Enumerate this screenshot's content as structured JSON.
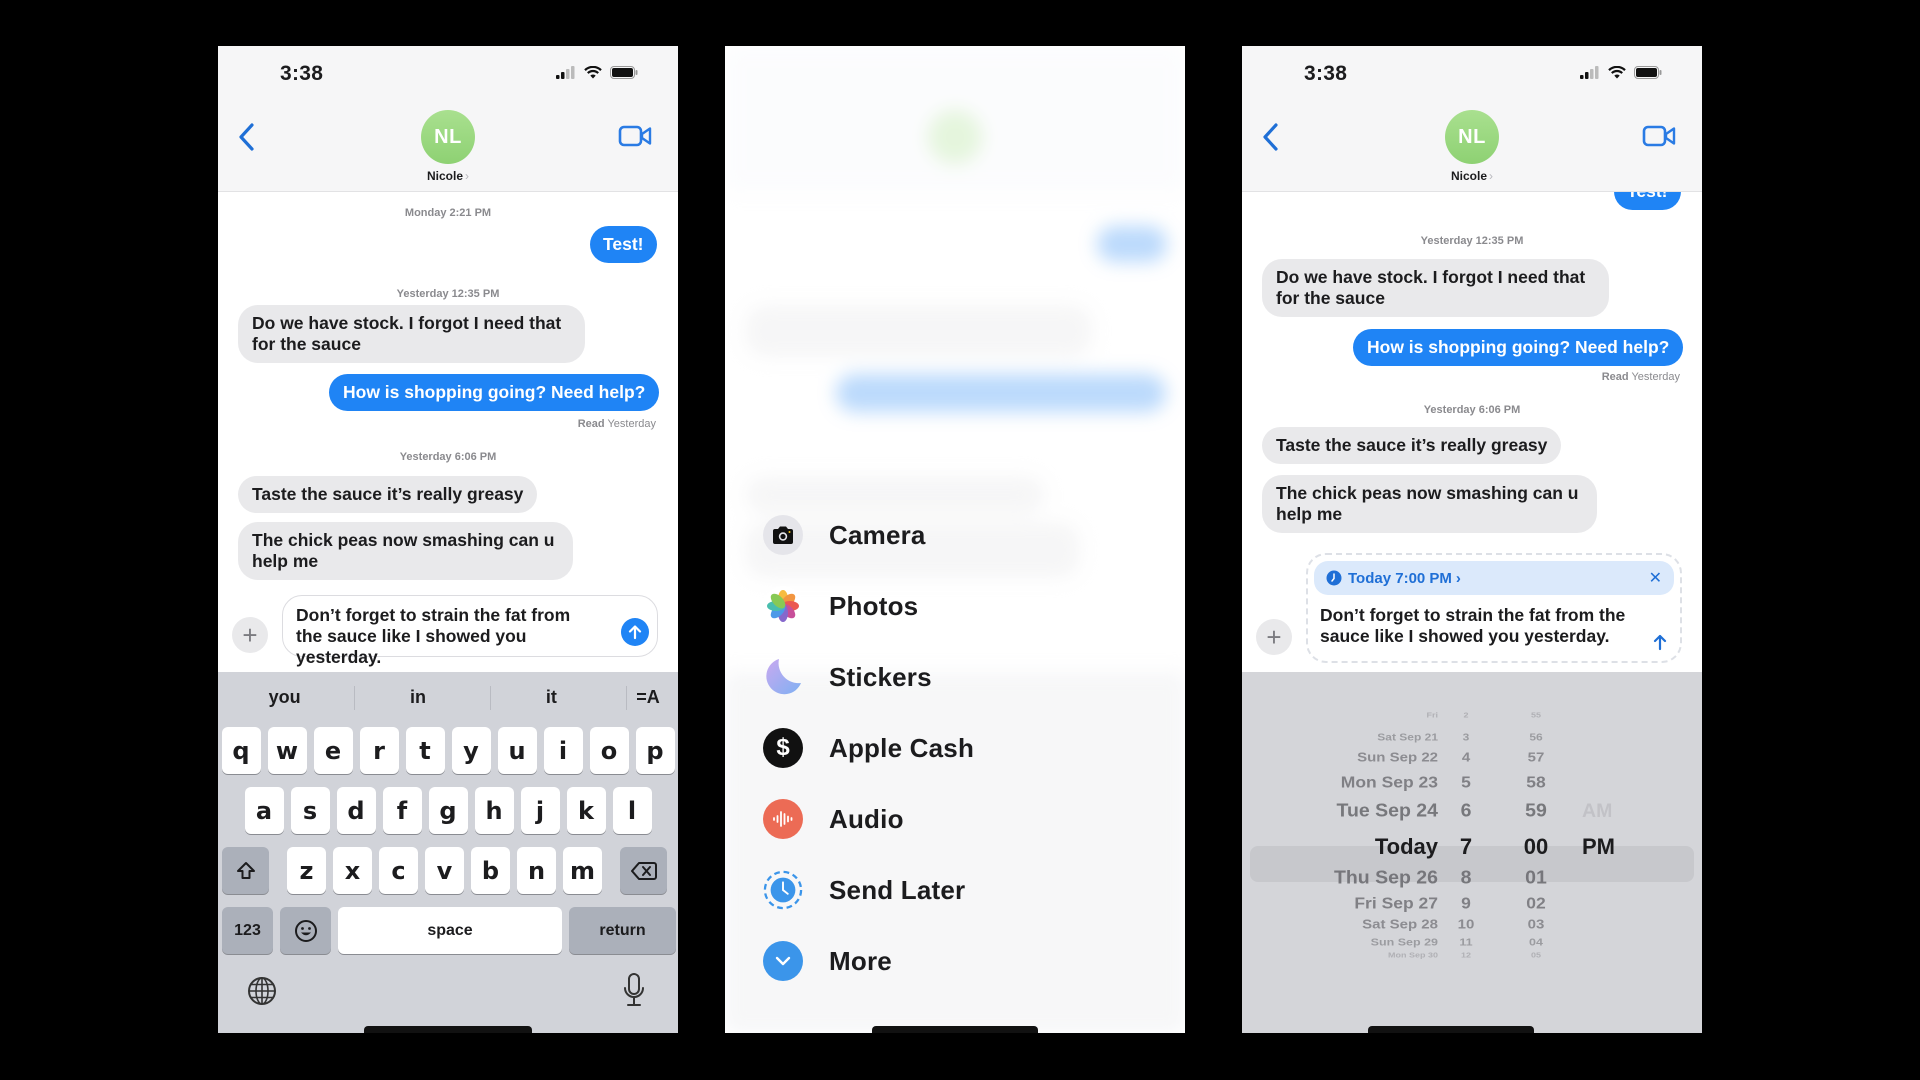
{
  "panels": [
    {
      "status_time": "3:38",
      "contact": {
        "initials": "NL",
        "name": "Nicole",
        "chevron": "›"
      },
      "messages": [
        {
          "type": "timestamp",
          "text": "Monday 2:21 PM"
        },
        {
          "type": "outgoing",
          "text": "Test!"
        },
        {
          "type": "timestamp",
          "text": "Yesterday 12:35 PM"
        },
        {
          "type": "incoming",
          "text": "Do we have stock. I forgot I need that for the sauce"
        },
        {
          "type": "outgoing",
          "text": "How is shopping going? Need help?"
        },
        {
          "type": "receipt",
          "bold": "Read",
          "text": "Yesterday"
        },
        {
          "type": "timestamp",
          "text": "Yesterday 6:06 PM"
        },
        {
          "type": "incoming",
          "text": "Taste the sauce it’s really greasy"
        },
        {
          "type": "incoming",
          "text": "The chick peas now smashing can u help me"
        }
      ],
      "composer": {
        "text": "Don’t forget to strain the fat from the sauce like I showed you yesterday."
      },
      "keyboard": {
        "suggestions": [
          "you",
          "in",
          "it"
        ],
        "format_icon": "=A",
        "row1": [
          "q",
          "w",
          "e",
          "r",
          "t",
          "y",
          "u",
          "i",
          "o",
          "p"
        ],
        "row2": [
          "a",
          "s",
          "d",
          "f",
          "g",
          "h",
          "j",
          "k",
          "l"
        ],
        "row3": [
          "z",
          "x",
          "c",
          "v",
          "b",
          "n",
          "m"
        ],
        "numbers_key": "123",
        "space_key": "space",
        "return_key": "return"
      }
    },
    {
      "menu": [
        {
          "label": "Camera",
          "icon": "camera-icon",
          "color": "#e5e5ea"
        },
        {
          "label": "Photos",
          "icon": "photos-icon",
          "color": "#ffffff"
        },
        {
          "label": "Stickers",
          "icon": "stickers-icon",
          "color": "#a7b3f5"
        },
        {
          "label": "Apple Cash",
          "icon": "dollar-icon",
          "color": "#111111"
        },
        {
          "label": "Audio",
          "icon": "waveform-icon",
          "color": "#ec6b55"
        },
        {
          "label": "Send Later",
          "icon": "clock-icon",
          "color": "#3b95ea"
        },
        {
          "label": "More",
          "icon": "chevron-down-icon",
          "color": "#3b95ea"
        }
      ]
    },
    {
      "status_time": "3:38",
      "contact": {
        "initials": "NL",
        "name": "Nicole",
        "chevron": "›"
      },
      "messages": [
        {
          "type": "outgoing",
          "text": "Test!"
        },
        {
          "type": "timestamp",
          "text": "Yesterday 12:35 PM"
        },
        {
          "type": "incoming",
          "text": "Do we have stock. I forgot I need that for the sauce"
        },
        {
          "type": "outgoing",
          "text": "How is shopping going? Need help?"
        },
        {
          "type": "receipt",
          "bold": "Read",
          "text": "Yesterday"
        },
        {
          "type": "timestamp",
          "text": "Yesterday 6:06 PM"
        },
        {
          "type": "incoming",
          "text": "Taste the sauce it’s really greasy"
        },
        {
          "type": "incoming",
          "text": "The chick peas now smashing can u help me"
        }
      ],
      "scheduled": {
        "when": "Today 7:00 PM",
        "chevron": "›",
        "close": "✕",
        "text": "Don’t forget to strain the fat from the sauce like I showed you yesterday."
      },
      "picker": {
        "days": [
          "Fri",
          "Sat Sep 21",
          "Sun Sep 22",
          "Mon Sep 23",
          "Tue Sep 24",
          "Today",
          "Thu Sep 26",
          "Fri Sep 27",
          "Sat Sep 28",
          "Sun Sep 29",
          "Mon Sep 30"
        ],
        "hours": [
          "2",
          "3",
          "4",
          "5",
          "6",
          "7",
          "8",
          "9",
          "10",
          "11",
          "12"
        ],
        "minutes": [
          "55",
          "56",
          "57",
          "58",
          "59",
          "00",
          "01",
          "02",
          "03",
          "04",
          "05"
        ],
        "ampm": [
          "AM",
          "PM"
        ],
        "selected": {
          "day": "Today",
          "hour": "7",
          "minute": "00",
          "ampm": "PM"
        }
      }
    }
  ],
  "colors": {
    "imessage_blue": "#1f84f5",
    "incoming_gray": "#e9e9eb",
    "avatar_green": "#9bd97f"
  }
}
